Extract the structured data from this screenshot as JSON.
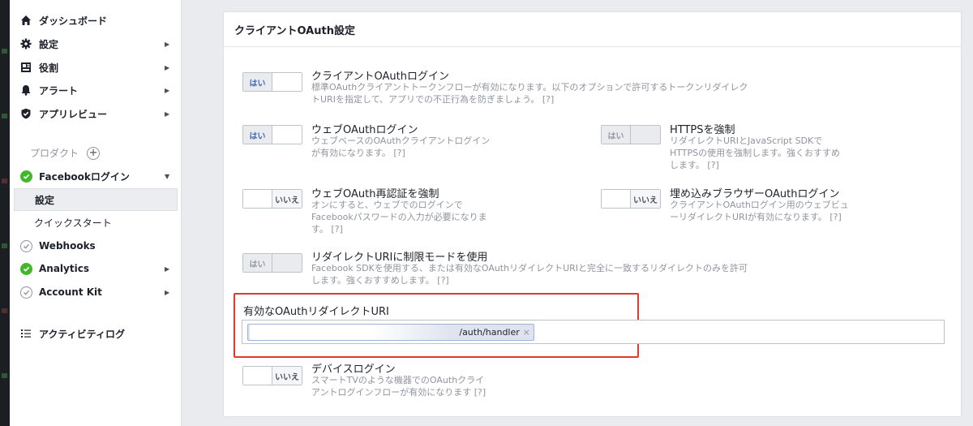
{
  "sidebar": {
    "dashboard": "ダッシュボード",
    "settings": "設定",
    "roles": "役割",
    "alerts": "アラート",
    "app_review": "アプリレビュー",
    "products_label": "プロダクト",
    "facebook_login": "Facebookログイン",
    "fb_settings": "設定",
    "quickstart": "クイックスタート",
    "webhooks": "Webhooks",
    "analytics": "Analytics",
    "account_kit": "Account Kit",
    "activity_log": "アクティビティログ"
  },
  "panel": {
    "title": "クライアントOAuth設定"
  },
  "settings": {
    "client_oauth": {
      "title": "クライアントOAuthログイン",
      "desc_line1": "標準OAuthクライアントトークンフローが有効になります。以下のオプションで許可するトークンリダイレク",
      "desc_line2": "トURIを指定して、アプリでの不正行為を防ぎましょう。 [?]",
      "toggle": "はい",
      "state": "on"
    },
    "web_oauth": {
      "title": "ウェブOAuthログイン",
      "desc_line1": "ウェブベースのOAuthクライアントログイン",
      "desc_line2": "が有効になります。 [?]",
      "toggle": "はい",
      "state": "on"
    },
    "https": {
      "title": "HTTPSを強制",
      "desc_line1": "リダイレクトURIとJavaScript SDKで",
      "desc_line2": "HTTPSの使用を強制します。強くおすすめ",
      "desc_line3": "します。 [?]",
      "toggle": "はい",
      "state": "disabled-on"
    },
    "reauth": {
      "title": "ウェブOAuth再認証を強制",
      "desc_line1": "オンにすると、ウェブでのログインで",
      "desc_line2": "Facebookパスワードの入力が必要になりま",
      "desc_line3": "す。 [?]",
      "toggle": "いいえ",
      "state": "off"
    },
    "embedded": {
      "title": "埋め込みブラウザーOAuthログイン",
      "desc_line1": "クライアントOAuthログイン用のウェブビュ",
      "desc_line2": "ーリダイレクトURIが有効になります。 [?]",
      "toggle": "いいえ",
      "state": "off"
    },
    "strict": {
      "title": "リダイレクトURIに制限モードを使用",
      "desc_line1": "Facebook SDKを使用する、または有効なOAuthリダイレクトURIと完全に一致するリダイレクトのみを許可",
      "desc_line2": "します。強くおすすめします。 [?]",
      "toggle": "はい",
      "state": "disabled-on"
    },
    "device": {
      "title": "デバイスログイン",
      "desc_line1": "スマートTVのような機器でのOAuthクライ",
      "desc_line2": "アントログインフローが有効になります [?]",
      "toggle": "いいえ",
      "state": "off"
    }
  },
  "redirect": {
    "label": "有効なOAuthリダイレクトURI",
    "token_text": "/auth/handler",
    "token_remove": "×"
  },
  "colors": {
    "highlight_border": "#e03a2f",
    "active_check": "#42b72a",
    "toggle_yes_text": "#4267b2"
  }
}
